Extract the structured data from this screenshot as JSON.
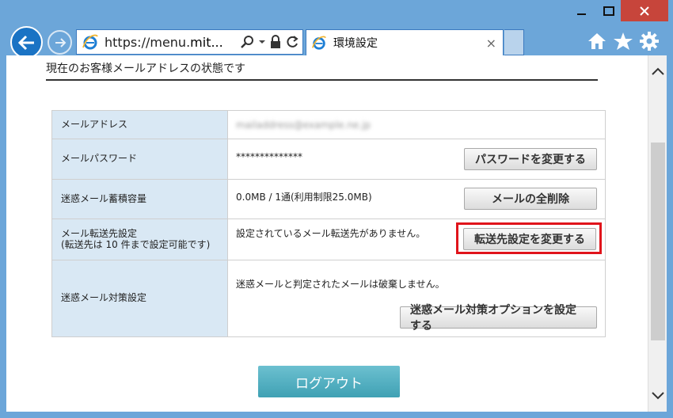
{
  "browser": {
    "url_prefix": "https://menu.",
    "url_host": "mit...",
    "tab_title": "環境設定",
    "tab_close": "×"
  },
  "page": {
    "heading": "現在のお客様メールアドレスの状態です",
    "rows": [
      {
        "label": "メールアドレス",
        "value": "mailaddress@example.ne.jp"
      },
      {
        "label": "メールパスワード",
        "value": "**************",
        "button": "パスワードを変更する"
      },
      {
        "label": "迷惑メール蓄積容量",
        "value": "0.0MB / 1通(利用制限25.0MB)",
        "button": "メールの全削除"
      },
      {
        "label_line1": "メール転送先設定",
        "label_line2": "(転送先は 10 件まで設定可能です)",
        "value": "設定されているメール転送先がありません。",
        "button": "転送先設定を変更する"
      },
      {
        "label": "迷惑メール対策設定",
        "value": "迷惑メールと判定されたメールは破棄しません。",
        "button": "迷惑メール対策オプションを設定する"
      }
    ],
    "logout": "ログアウト"
  },
  "colors": {
    "highlight": "#e0141b",
    "label_bg": "#d9e8f4",
    "logout_bg": "#4fb0c2",
    "frame": "#6ca6d9"
  }
}
